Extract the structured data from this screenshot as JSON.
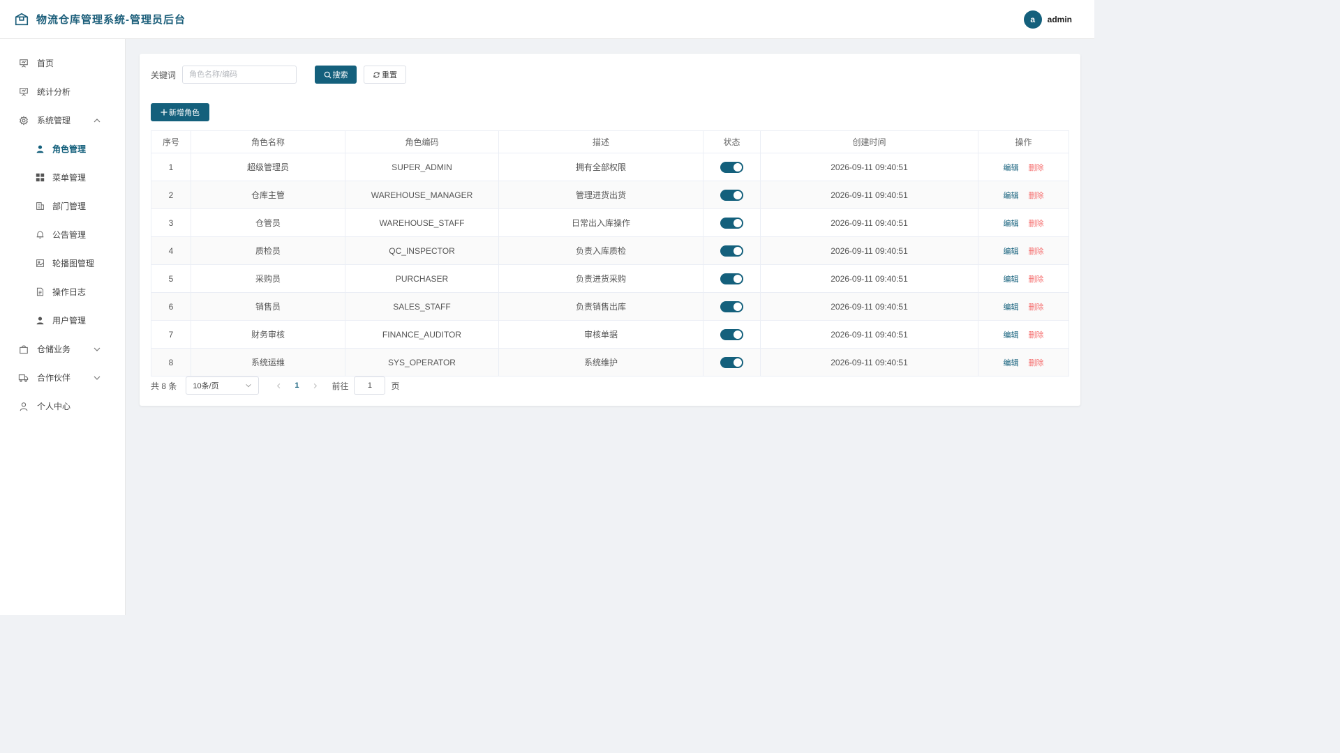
{
  "header": {
    "title": "物流仓库管理系统-管理员后台",
    "avatar_letter": "a",
    "username": "admin"
  },
  "sidebar": {
    "items": [
      {
        "label": "首页",
        "icon": "presentation-icon"
      },
      {
        "label": "统计分析",
        "icon": "presentation-icon"
      },
      {
        "label": "系统管理",
        "icon": "gear-icon",
        "expanded": true
      },
      {
        "label": "角色管理",
        "icon": "user-filled-icon",
        "active": true
      },
      {
        "label": "菜单管理",
        "icon": "grid-icon"
      },
      {
        "label": "部门管理",
        "icon": "building-icon"
      },
      {
        "label": "公告管理",
        "icon": "bell-icon"
      },
      {
        "label": "轮播图管理",
        "icon": "image-icon"
      },
      {
        "label": "操作日志",
        "icon": "document-icon"
      },
      {
        "label": "用户管理",
        "icon": "user-filled-icon"
      },
      {
        "label": "仓储业务",
        "icon": "bag-icon",
        "expanded": false
      },
      {
        "label": "合作伙伴",
        "icon": "truck-icon",
        "expanded": false
      },
      {
        "label": "个人中心",
        "icon": "user-outline-icon"
      }
    ]
  },
  "search": {
    "label": "关键词",
    "placeholder": "角色名称/编码",
    "search_label": "搜索",
    "reset_label": "重置"
  },
  "toolbar": {
    "add_label": "新增角色"
  },
  "table": {
    "headers": [
      "序号",
      "角色名称",
      "角色编码",
      "描述",
      "状态",
      "创建时间",
      "操作"
    ],
    "rows": [
      {
        "no": "1",
        "name": "超级管理员",
        "code": "SUPER_ADMIN",
        "desc": "拥有全部权限",
        "enabled": true,
        "created": "2026-09-11 09:40:51"
      },
      {
        "no": "2",
        "name": "仓库主管",
        "code": "WAREHOUSE_MANAGER",
        "desc": "管理进货出货",
        "enabled": true,
        "created": "2026-09-11 09:40:51"
      },
      {
        "no": "3",
        "name": "仓管员",
        "code": "WAREHOUSE_STAFF",
        "desc": "日常出入库操作",
        "enabled": true,
        "created": "2026-09-11 09:40:51"
      },
      {
        "no": "4",
        "name": "质检员",
        "code": "QC_INSPECTOR",
        "desc": "负责入库质检",
        "enabled": true,
        "created": "2026-09-11 09:40:51"
      },
      {
        "no": "5",
        "name": "采购员",
        "code": "PURCHASER",
        "desc": "负责进货采购",
        "enabled": true,
        "created": "2026-09-11 09:40:51"
      },
      {
        "no": "6",
        "name": "销售员",
        "code": "SALES_STAFF",
        "desc": "负责销售出库",
        "enabled": true,
        "created": "2026-09-11 09:40:51"
      },
      {
        "no": "7",
        "name": "财务审核",
        "code": "FINANCE_AUDITOR",
        "desc": "审核单据",
        "enabled": true,
        "created": "2026-09-11 09:40:51"
      },
      {
        "no": "8",
        "name": "系统运维",
        "code": "SYS_OPERATOR",
        "desc": "系统维护",
        "enabled": true,
        "created": "2026-09-11 09:40:51"
      }
    ],
    "edit_label": "编辑",
    "delete_label": "删除"
  },
  "pagination": {
    "total_text": "共 8 条",
    "page_size": "10条/页",
    "current_page": "1",
    "goto_label": "前往",
    "goto_value": "1",
    "goto_suffix": "页"
  },
  "colors": {
    "primary": "#14607c",
    "danger": "#f56c6c",
    "background": "#f0f2f5"
  }
}
